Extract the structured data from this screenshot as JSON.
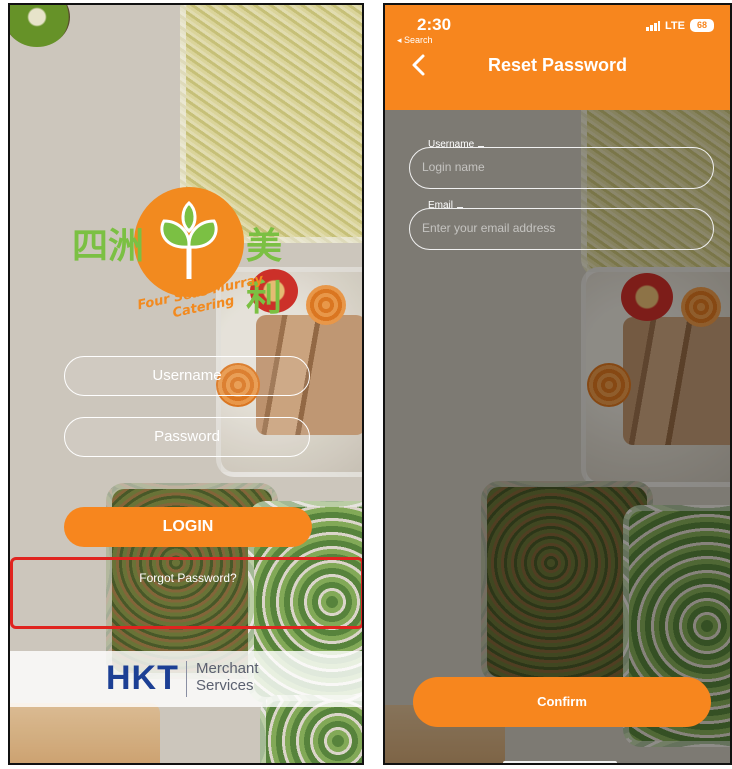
{
  "login_screen": {
    "logo": {
      "chinese_left": "四洲",
      "chinese_right": "美利",
      "english": "Four Seas Murray Catering"
    },
    "username_label": "Username",
    "password_label": "Password",
    "login_button": "LOGIN",
    "forgot_password": "Forgot Password?",
    "footer": {
      "brand": "HKT",
      "tagline_line1": "Merchant",
      "tagline_line2": "Services"
    }
  },
  "reset_screen": {
    "status_bar": {
      "time": "2:30",
      "back_app": "◂ Search",
      "network": "LTE",
      "battery": "68"
    },
    "title": "Reset Password",
    "fields": [
      {
        "label": "Username",
        "placeholder": "Login name"
      },
      {
        "label": "Email",
        "placeholder": "Enter your email address"
      }
    ],
    "confirm_button": "Confirm"
  },
  "colors": {
    "accent_orange": "#f7861e",
    "highlight_red": "#e0241f",
    "hkt_blue": "#1c3f94",
    "logo_green": "#7bc043"
  }
}
